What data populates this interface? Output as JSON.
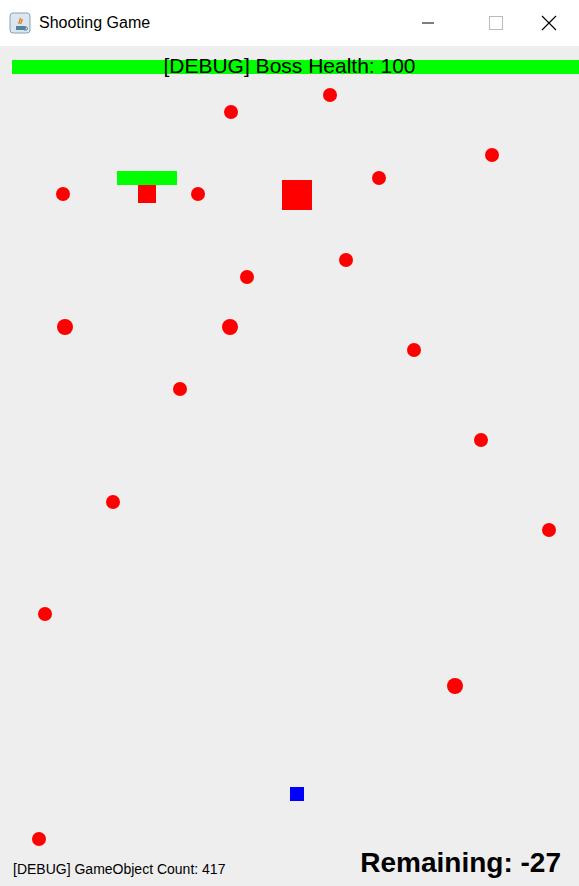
{
  "window": {
    "title": "Shooting Game"
  },
  "boss_health": {
    "label": "[DEBUG] Boss Health: 100",
    "level": 1.0
  },
  "enemy_health": {
    "level": 1.0
  },
  "status": {
    "object_count": "[DEBUG] GameObject Count: 417",
    "remaining": "Remaining: -27"
  }
}
